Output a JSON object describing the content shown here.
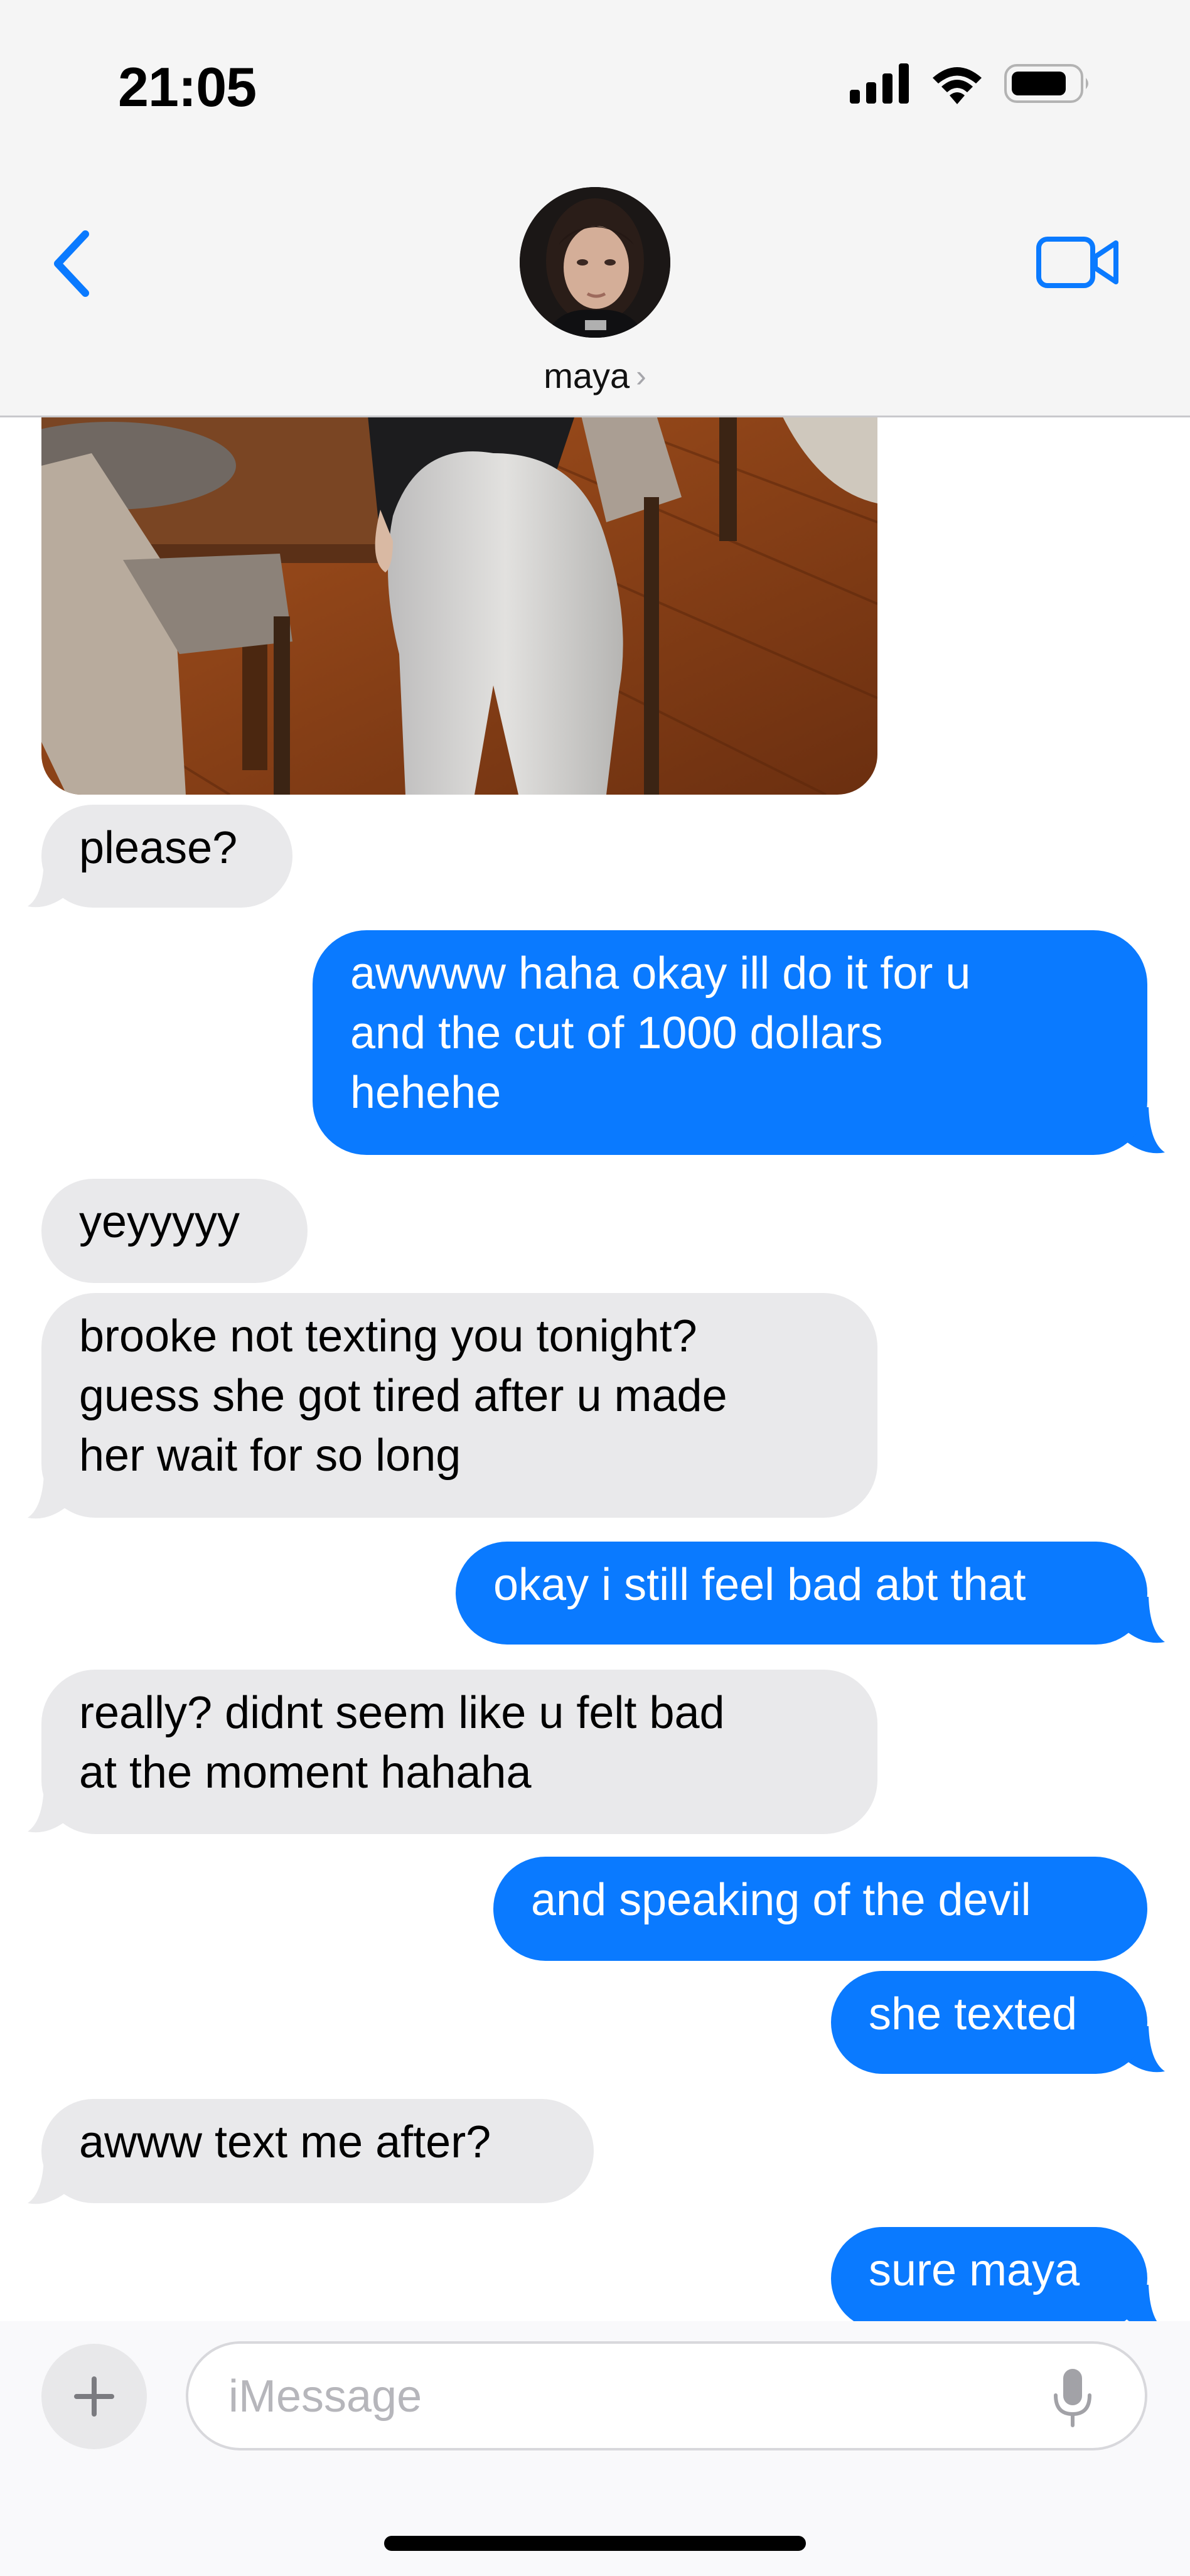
{
  "status_bar": {
    "time": "21:05",
    "icons": [
      "cellular-signal-icon",
      "wifi-icon",
      "battery-icon"
    ]
  },
  "header": {
    "contact_name": "maya",
    "back_icon": "chevron-left-icon",
    "video_icon": "video-camera-icon"
  },
  "messages": [
    {
      "direction": "in",
      "text": "please?"
    },
    {
      "direction": "out",
      "text": "awwww haha okay ill do it for u\nand the cut of 1000 dollars\nhehehe"
    },
    {
      "direction": "in",
      "text": "yeyyyyy"
    },
    {
      "direction": "in",
      "text": "brooke not texting you tonight?\nguess she got tired after u made\nher wait for so long"
    },
    {
      "direction": "out",
      "text": "okay i still feel bad abt that"
    },
    {
      "direction": "in",
      "text": "really? didnt seem like u felt bad\nat the moment hahaha"
    },
    {
      "direction": "out",
      "text": "and speaking of the devil"
    },
    {
      "direction": "out",
      "text": "she texted"
    },
    {
      "direction": "in",
      "text": "awww text me after?"
    },
    {
      "direction": "out",
      "text": "sure maya"
    }
  ],
  "composer": {
    "placeholder": "iMessage",
    "value": ""
  },
  "colors": {
    "outgoing_bubble": "#0a7aff",
    "incoming_bubble": "#e9e9eb",
    "accent": "#0a7aff"
  }
}
